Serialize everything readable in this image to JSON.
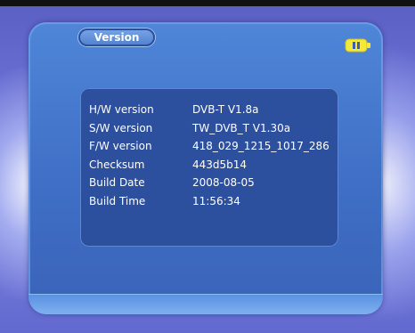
{
  "title": "Version",
  "rows": [
    {
      "label": "H/W version",
      "value": "DVB-T V1.8a"
    },
    {
      "label": "S/W version",
      "value": "TW_DVB_T V1.30a"
    },
    {
      "label": "F/W version",
      "value": "418_029_1215_1017_286"
    },
    {
      "label": "Checksum",
      "value": "443d5b14"
    },
    {
      "label": "Build Date",
      "value": "2008-08-05"
    },
    {
      "label": "Build Time",
      "value": "11:56:34"
    }
  ],
  "icons": {
    "battery": "battery-icon"
  },
  "colors": {
    "panel": "#3f6fc6",
    "info_box": "#2c4f9e",
    "battery": "#f2e93a"
  }
}
